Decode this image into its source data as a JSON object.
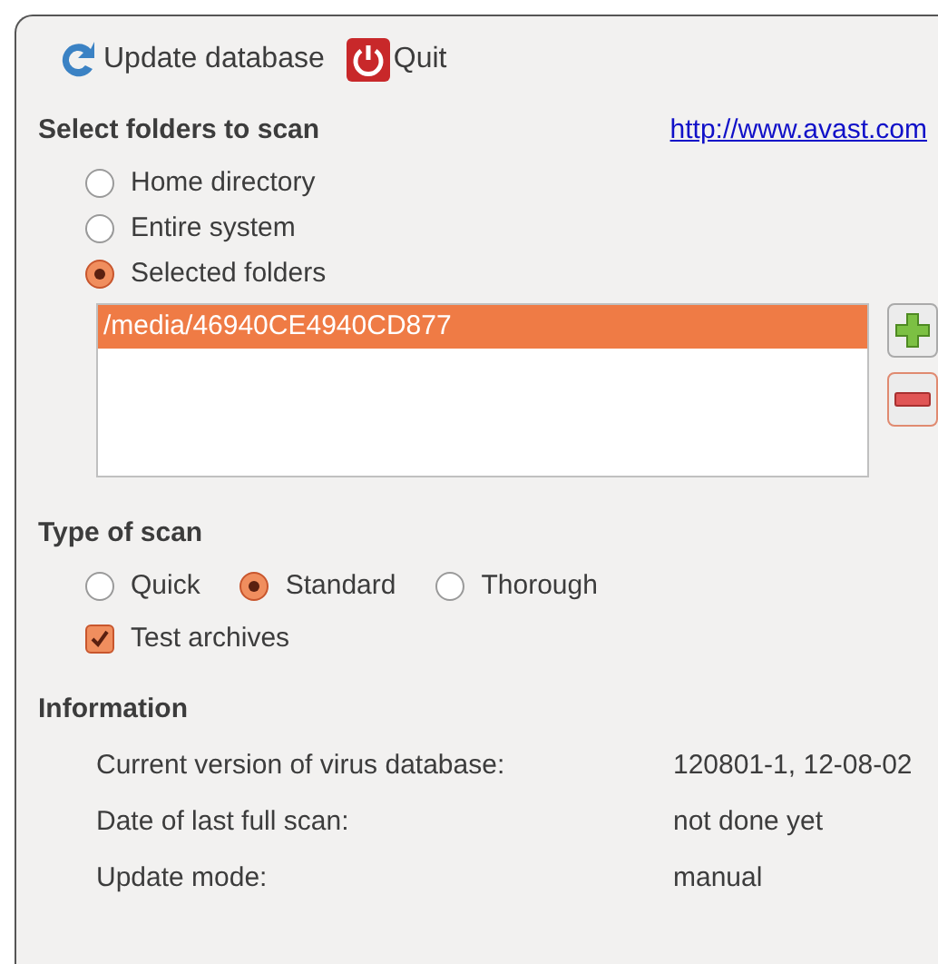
{
  "toolbar": {
    "buttons": [
      {
        "kind": "update",
        "label": "Update database"
      },
      {
        "kind": "quit",
        "label": "Quit"
      }
    ]
  },
  "folders": {
    "heading": "Select folders to scan",
    "link": "http://www.avast.com",
    "options": [
      {
        "label": "Home directory",
        "selected": false
      },
      {
        "label": "Entire system",
        "selected": false
      },
      {
        "label": "Selected folders",
        "selected": true
      }
    ],
    "list": [
      {
        "path": "/media/46940CE4940CD877",
        "selected": true
      }
    ]
  },
  "scan_type": {
    "heading": "Type of scan",
    "options": [
      {
        "label": "Quick",
        "selected": false
      },
      {
        "label": "Standard",
        "selected": true
      },
      {
        "label": "Thorough",
        "selected": false
      }
    ],
    "test_archives": {
      "label": "Test archives",
      "checked": true
    }
  },
  "information": {
    "heading": "Information",
    "rows": [
      {
        "label": "Current version of virus database:",
        "value": "120801-1, 12-08-02"
      },
      {
        "label": "Date of last full scan:",
        "value": "not done yet"
      },
      {
        "label": "Update mode:",
        "value": "manual"
      }
    ]
  }
}
